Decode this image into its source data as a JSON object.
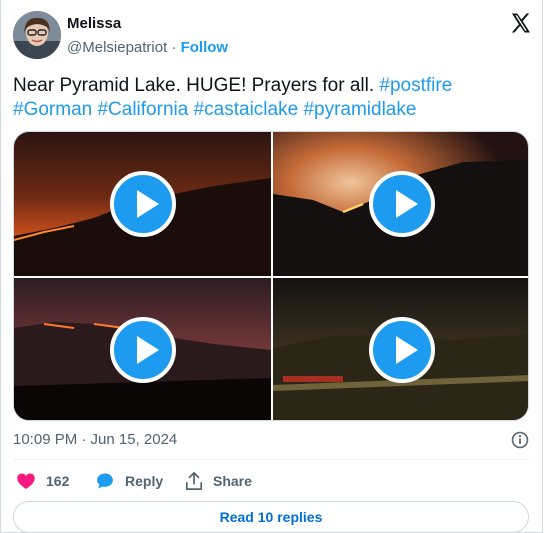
{
  "author": {
    "name": "Melissa",
    "handle": "@Melsiepatriot",
    "separator": "·",
    "follow_label": "Follow"
  },
  "tweet": {
    "text": "Near Pyramid Lake. HUGE! Prayers for all.",
    "hashtags": [
      "#postfire",
      "#Gorman",
      "#California",
      "#castaiclake",
      "#pyramidlake"
    ]
  },
  "media": {
    "videos": [
      {
        "icon": "play-icon"
      },
      {
        "icon": "play-icon"
      },
      {
        "icon": "play-icon"
      },
      {
        "icon": "play-icon"
      }
    ]
  },
  "meta": {
    "timestamp": "10:09 PM · Jun 15, 2024",
    "info_icon": "info-icon"
  },
  "actions": {
    "like_count": "162",
    "reply_label": "Reply",
    "share_label": "Share"
  },
  "read_replies_label": "Read 10 replies",
  "colors": {
    "accent": "#1d9bf0",
    "like": "#f91880",
    "text": "#0f1419",
    "muted": "#536471"
  }
}
